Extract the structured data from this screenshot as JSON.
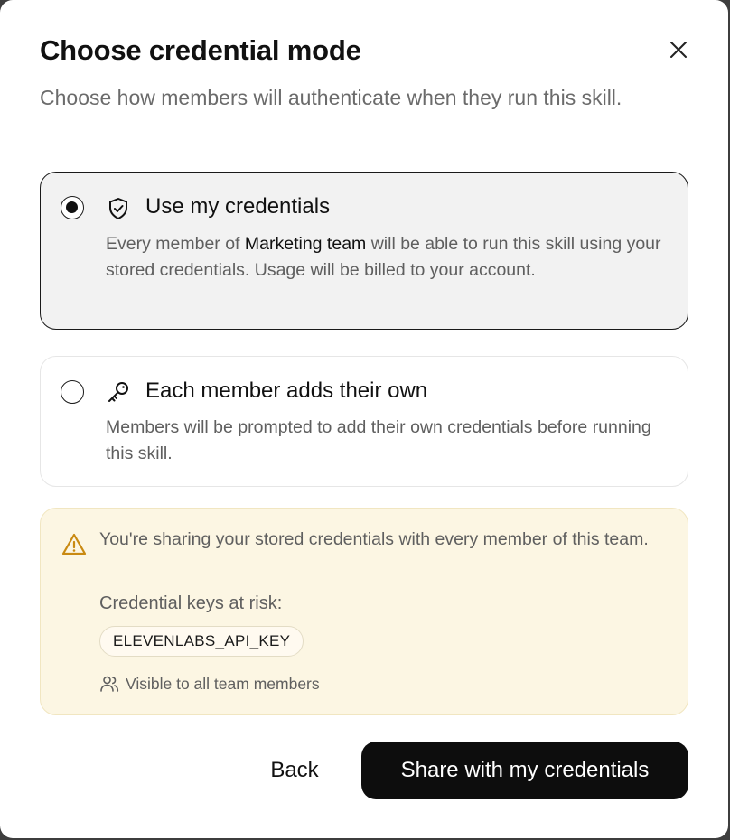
{
  "dialog": {
    "title": "Choose credential mode",
    "subtitle": "Choose how members will authenticate when they run this skill.",
    "close_icon": "close-icon"
  },
  "options": [
    {
      "title": "Use my credentials",
      "icon": "shield-check-icon",
      "selected": true,
      "description_before": "Every member of ",
      "description_highlight": "Marketing team",
      "description_after": " will be able to run this skill using your stored credentials. Usage will be billed to your account."
    },
    {
      "title": "Each member adds their own",
      "icon": "key-icon",
      "selected": false,
      "description": "Members will be prompted to add their own credentials before running this skill."
    }
  ],
  "warning": {
    "icon": "warning-triangle-icon",
    "message": "You're sharing your stored credentials with every member of this team.",
    "keys_label": "Credential keys at risk:",
    "keys": [
      "ELEVENLABS_API_KEY"
    ],
    "visibility_icon": "users-icon",
    "visibility_text": "Visible to all team members"
  },
  "actions": {
    "back_label": "Back",
    "primary_label": "Share with my credentials"
  },
  "colors": {
    "warning_bg": "#fcf6e3",
    "selected_bg": "#f2f2f2",
    "primary_bg": "#0d0d0d"
  }
}
